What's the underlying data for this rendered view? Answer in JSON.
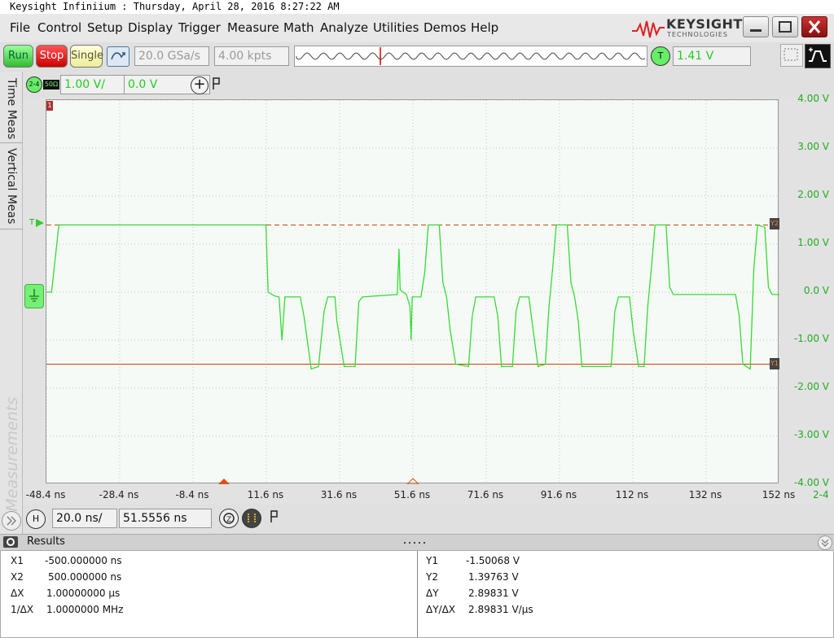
{
  "window": {
    "title": "Keysight Infiniium : Thursday, April 28, 2016 8:27:22 AM"
  },
  "menu": [
    "File",
    "Control",
    "Setup",
    "Display",
    "Trigger",
    "Measure",
    "Math",
    "Analyze",
    "Utilities",
    "Demos",
    "Help"
  ],
  "brand": {
    "name": "KEYSIGHT",
    "sub": "TECHNOLOGIES"
  },
  "toolbar": {
    "run": "Run",
    "stop": "Stop",
    "single": "Single",
    "sample_rate": "20.0 GSa/s",
    "memory_depth": "4.00 kpts",
    "trigger_badge": "T",
    "trigger_level": "1.41 V"
  },
  "vertical": {
    "channel": "2-4",
    "impedance": "50Ω",
    "scale": "1.00 V/",
    "offset": "0.0 V"
  },
  "sidetabs": {
    "time_meas": "Time Meas",
    "vertical_meas": "Vertical Meas",
    "measurements": "Measurements"
  },
  "graticule": {
    "y_labels": [
      "4.00 V",
      "3.00 V",
      "2.00 V",
      "1.00 V",
      "0.0 V",
      "-1.00 V",
      "-2.00 V",
      "-3.00 V",
      "-4.00 V"
    ],
    "x_labels": [
      "-48.4 ns",
      "-28.4 ns",
      "-8.4 ns",
      "11.6 ns",
      "31.6 ns",
      "51.6 ns",
      "71.6 ns",
      "91.6 ns",
      "112 ns",
      "132 ns",
      "152 ns"
    ],
    "channel_tag": "2-4",
    "trigger_marker": "T",
    "marker_1": "1",
    "marker_y2": "Y2",
    "marker_y1": "Y1"
  },
  "chart_data": {
    "type": "line",
    "series": [
      {
        "points": [
          [
            -48.4,
            0
          ],
          [
            -47,
            0
          ],
          [
            -45,
            1.4
          ],
          [
            11.6,
            1.4
          ],
          [
            12.2,
            0
          ],
          [
            14,
            -0.08
          ],
          [
            15.2,
            -0.1
          ],
          [
            16,
            -1.0
          ],
          [
            16.8,
            -0.1
          ],
          [
            21,
            -0.1
          ],
          [
            22,
            -0.5
          ],
          [
            24,
            -1.6
          ],
          [
            26,
            -1.55
          ],
          [
            27.5,
            -0.4
          ],
          [
            28.5,
            -0.1
          ],
          [
            30.5,
            -0.1
          ],
          [
            31,
            -0.6
          ],
          [
            33,
            -1.55
          ],
          [
            36,
            -1.55
          ],
          [
            37,
            -0.2
          ],
          [
            38,
            -0.1
          ],
          [
            47.5,
            -0.05
          ],
          [
            48,
            0.9
          ],
          [
            48.3,
            0.05
          ],
          [
            50,
            -0.05
          ],
          [
            51,
            -0.3
          ],
          [
            51.3,
            -1.0
          ],
          [
            51.6,
            -0.1
          ],
          [
            54,
            -0.1
          ],
          [
            55,
            0.4
          ],
          [
            56,
            1.4
          ],
          [
            59,
            1.4
          ],
          [
            60,
            0.2
          ],
          [
            61,
            -0.1
          ],
          [
            62,
            -0.8
          ],
          [
            63.5,
            -1.5
          ],
          [
            67,
            -1.55
          ],
          [
            68,
            -0.5
          ],
          [
            69,
            -0.1
          ],
          [
            74,
            -0.1
          ],
          [
            75,
            -0.5
          ],
          [
            76,
            -1.55
          ],
          [
            79,
            -1.55
          ],
          [
            80,
            -0.4
          ],
          [
            81,
            -0.1
          ],
          [
            83.5,
            -0.1
          ],
          [
            84.5,
            -0.7
          ],
          [
            86,
            -1.55
          ],
          [
            88,
            -1.5
          ],
          [
            89,
            -0.3
          ],
          [
            90,
            0.5
          ],
          [
            91,
            1.4
          ],
          [
            94,
            1.4
          ],
          [
            95,
            0.2
          ],
          [
            96,
            -0.1
          ],
          [
            97,
            -0.6
          ],
          [
            98,
            -1.55
          ],
          [
            106,
            -1.55
          ],
          [
            107,
            -0.4
          ],
          [
            108,
            -0.1
          ],
          [
            111,
            -0.1
          ],
          [
            112,
            -0.8
          ],
          [
            113.5,
            -1.55
          ],
          [
            115,
            -1.55
          ],
          [
            116,
            -0.3
          ],
          [
            117,
            0.5
          ],
          [
            118,
            1.4
          ],
          [
            121,
            1.4
          ],
          [
            122,
            0.1
          ],
          [
            123,
            -0.05
          ],
          [
            140,
            -0.05
          ],
          [
            141,
            -0.5
          ],
          [
            142,
            -1.5
          ],
          [
            144,
            -1.6
          ],
          [
            145,
            0.5
          ],
          [
            146,
            1.4
          ],
          [
            148,
            1.35
          ],
          [
            149,
            0.1
          ],
          [
            150,
            -0.05
          ],
          [
            152,
            -0.05
          ]
        ]
      }
    ],
    "ylim": [
      -4,
      4
    ],
    "xlim": [
      -48.4,
      152
    ],
    "color": "#33dd33",
    "cursor_y1": -1.50068,
    "cursor_y2": 1.39763
  },
  "horizontal": {
    "badge": "H",
    "scale": "20.0 ns/",
    "position": "51.5556 ns"
  },
  "results": {
    "title": "Results",
    "left": [
      {
        "label": "X1",
        "value": "-500.000000 ns"
      },
      {
        "label": "X2",
        "value": "500.000000 ns"
      },
      {
        "label": "ΔX",
        "value": "1.00000000 µs"
      },
      {
        "label": "1/ΔX",
        "value": "1.0000000 MHz"
      }
    ],
    "right": [
      {
        "label": "Y1",
        "value": "-1.50068 V"
      },
      {
        "label": "Y2",
        "value": "1.39763 V"
      },
      {
        "label": "ΔY",
        "value": "2.89831 V"
      },
      {
        "label": "ΔY/ΔX",
        "value": "2.89831 V/µs"
      }
    ]
  },
  "colors": {
    "trace": "#33dd33",
    "cursor_y1": "#cc4400",
    "cursor_y2": "#cc4400",
    "grid": "#b8c8b8"
  }
}
